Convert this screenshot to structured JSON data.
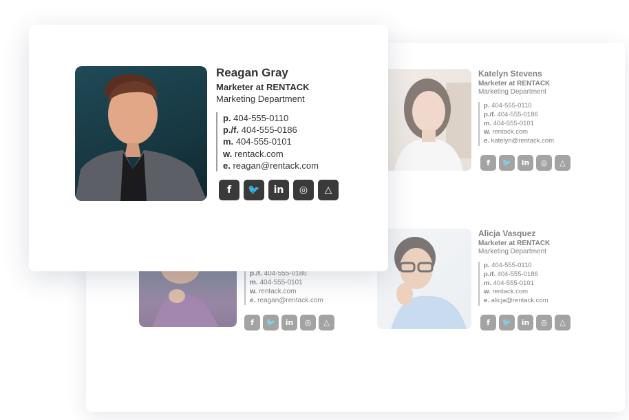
{
  "reagan_front": {
    "name": "Reagan Gray",
    "title": "Marketer at RENTACK",
    "department": "Marketing Department",
    "contacts": [
      {
        "label": "p.",
        "value": "404-555-0110"
      },
      {
        "label": "p./f.",
        "value": "404-555-0186"
      },
      {
        "label": "m.",
        "value": "404-555-0101"
      },
      {
        "label": "w.",
        "value": "rentack.com"
      },
      {
        "label": "e.",
        "value": "reagan@rentack.com"
      }
    ]
  },
  "katelyn": {
    "name": "Katelyn Stevens",
    "title": "Marketer at RENTACK",
    "department": "Marketing Department",
    "contacts": [
      {
        "label": "p.",
        "value": "404-555-0110"
      },
      {
        "label": "p./f.",
        "value": "404-555-0186"
      },
      {
        "label": "m.",
        "value": "404-555-0101"
      },
      {
        "label": "w.",
        "value": "rentack.com"
      },
      {
        "label": "e.",
        "value": "katelyn@rentack.com"
      }
    ]
  },
  "alicja": {
    "name": "Alicja Vasquez",
    "title": "Marketer at RENTACK",
    "department": "Marketing Department",
    "contacts": [
      {
        "label": "p.",
        "value": "404-555-0110"
      },
      {
        "label": "p./f.",
        "value": "404-555-0186"
      },
      {
        "label": "m.",
        "value": "404-555-0101"
      },
      {
        "label": "w.",
        "value": "rentack.com"
      },
      {
        "label": "e.",
        "value": "alicja@rentack.com"
      }
    ]
  },
  "reagan_back": {
    "contacts": [
      {
        "label": "p./f.",
        "value": "404-555-0186"
      },
      {
        "label": "m.",
        "value": "404-555-0101"
      },
      {
        "label": "w.",
        "value": "rentack.com"
      },
      {
        "label": "e.",
        "value": "reagan@rentack.com"
      }
    ]
  },
  "social_icons": [
    {
      "icon": "facebook-icon",
      "glyph": "f"
    },
    {
      "icon": "twitter-icon",
      "glyph": "🐦"
    },
    {
      "icon": "linkedin-icon",
      "glyph": "in"
    },
    {
      "icon": "instagram-icon",
      "glyph": "◎"
    },
    {
      "icon": "airbnb-icon",
      "glyph": "△"
    }
  ],
  "colors": {
    "social_dark": "#3a3a3a",
    "social_faded": "#6b6b6b",
    "text": "#333333",
    "divider": "#9aa0a6"
  }
}
